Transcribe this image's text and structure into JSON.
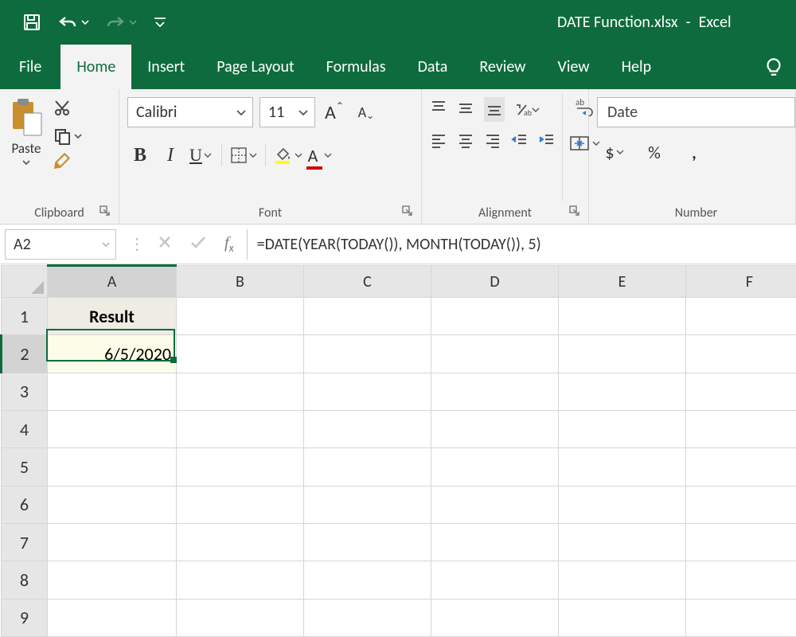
{
  "title": {
    "filename": "DATE Function.xlsx",
    "separator": "-",
    "app": "Excel"
  },
  "tabs": {
    "file": "File",
    "items": [
      "Home",
      "Insert",
      "Page Layout",
      "Formulas",
      "Data",
      "Review",
      "View",
      "Help"
    ],
    "active_index": 0
  },
  "ribbon": {
    "clipboard": {
      "label": "Clipboard",
      "paste": "Paste"
    },
    "font": {
      "label": "Font",
      "font_name": "Calibri",
      "font_size": "11",
      "increase_hint": "A",
      "decrease_hint": "A",
      "bold": "B",
      "italic": "I",
      "underline": "U",
      "font_color_letter": "A"
    },
    "alignment": {
      "label": "Alignment"
    },
    "number": {
      "label": "Number",
      "format": "Date",
      "currency": "$",
      "percent": "%",
      "comma": ","
    }
  },
  "formula_bar": {
    "cell_ref": "A2",
    "formula": "=DATE(YEAR(TODAY()), MONTH(TODAY()), 5)"
  },
  "grid": {
    "columns": [
      "A",
      "B",
      "C",
      "D",
      "E",
      "F"
    ],
    "rows": [
      "1",
      "2",
      "3",
      "4",
      "5",
      "6",
      "7",
      "8",
      "9"
    ],
    "active_col": "A",
    "active_row": "2",
    "cells": {
      "A1": "Result",
      "A2": "6/5/2020"
    }
  }
}
